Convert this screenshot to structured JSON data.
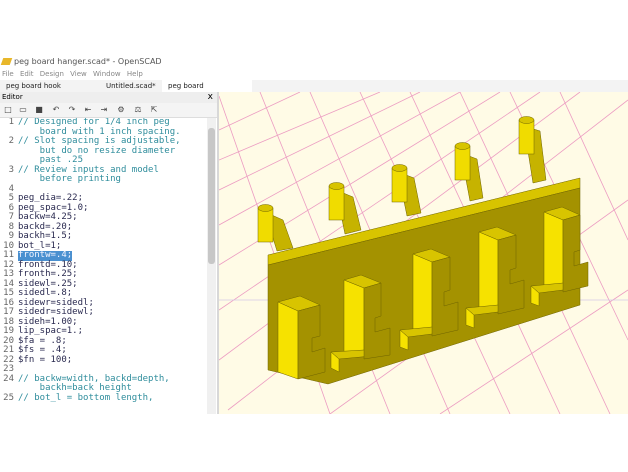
{
  "window": {
    "title": "peg board hanger.scad* - OpenSCAD"
  },
  "menu": [
    "File",
    "Edit",
    "Design",
    "View",
    "Window",
    "Help"
  ],
  "tabs": [
    {
      "label": "peg board hook system.scad"
    },
    {
      "label": "Untitled.scad*"
    },
    {
      "label": "peg board hanger.scad*",
      "close": "x"
    }
  ],
  "editor": {
    "title": "Editor",
    "close": "x"
  },
  "toolbar_icons": [
    "new-icon",
    "open-icon",
    "save-icon",
    "undo-icon",
    "redo-icon",
    "unindent-icon",
    "indent-icon",
    "preview-icon",
    "render-icon",
    "export-icon"
  ],
  "code": [
    {
      "n": "1",
      "t": "// Designed for 1/4 inch peg",
      "k": "cm"
    },
    {
      "n": "",
      "t": "    board with 1 inch spacing.",
      "k": "cm"
    },
    {
      "n": "2",
      "t": "// Slot spacing is adjustable,",
      "k": "cm"
    },
    {
      "n": "",
      "t": "    but do no resize diameter",
      "k": "cm"
    },
    {
      "n": "",
      "t": "    past .25",
      "k": "cm"
    },
    {
      "n": "3",
      "t": "// Review inputs and model",
      "k": "cm"
    },
    {
      "n": "",
      "t": "    before printing",
      "k": "cm"
    },
    {
      "n": "4",
      "t": "",
      "k": "cd"
    },
    {
      "n": "5",
      "t": "peg_dia=.22;",
      "k": "cd"
    },
    {
      "n": "6",
      "t": "peg_spac=1.0;",
      "k": "cd"
    },
    {
      "n": "7",
      "t": "backw=4.25;",
      "k": "cd"
    },
    {
      "n": "8",
      "t": "backd=.20;",
      "k": "cd"
    },
    {
      "n": "9",
      "t": "backh=1.5;",
      "k": "cd"
    },
    {
      "n": "10",
      "t": "bot_l=1;",
      "k": "cd"
    },
    {
      "n": "11",
      "t": "frontw=.4;",
      "k": "hl"
    },
    {
      "n": "12",
      "t": "frontd=.10;",
      "k": "cd"
    },
    {
      "n": "13",
      "t": "fronth=.25;",
      "k": "cd"
    },
    {
      "n": "14",
      "t": "sidewl=.25;",
      "k": "cd"
    },
    {
      "n": "15",
      "t": "sidedl=.8;",
      "k": "cd"
    },
    {
      "n": "16",
      "t": "sidewr=sidedl;",
      "k": "cd"
    },
    {
      "n": "17",
      "t": "sidedr=sidewl;",
      "k": "cd"
    },
    {
      "n": "18",
      "t": "sideh=1.00;",
      "k": "cd"
    },
    {
      "n": "19",
      "t": "lip_spac=1.;",
      "k": "cd"
    },
    {
      "n": "20",
      "t": "$fa = .8;",
      "k": "cd"
    },
    {
      "n": "21",
      "t": "$fs = .4;",
      "k": "cd"
    },
    {
      "n": "22",
      "t": "$fn = 100;",
      "k": "cd"
    },
    {
      "n": "23",
      "t": "",
      "k": "cd"
    },
    {
      "n": "24",
      "t": "// backw=width, backd=depth,",
      "k": "cm"
    },
    {
      "n": "",
      "t": "    backh=back height",
      "k": "cm"
    },
    {
      "n": "25",
      "t": "// bot_l = bottom length,",
      "k": "cm"
    }
  ],
  "colors": {
    "model_front": "#f6e200",
    "model_top": "#d8c400",
    "model_side": "#a49200",
    "viewport_bg": "#fffbe6",
    "grid": "#ec9cc2",
    "highlight": "#4a90d0"
  }
}
